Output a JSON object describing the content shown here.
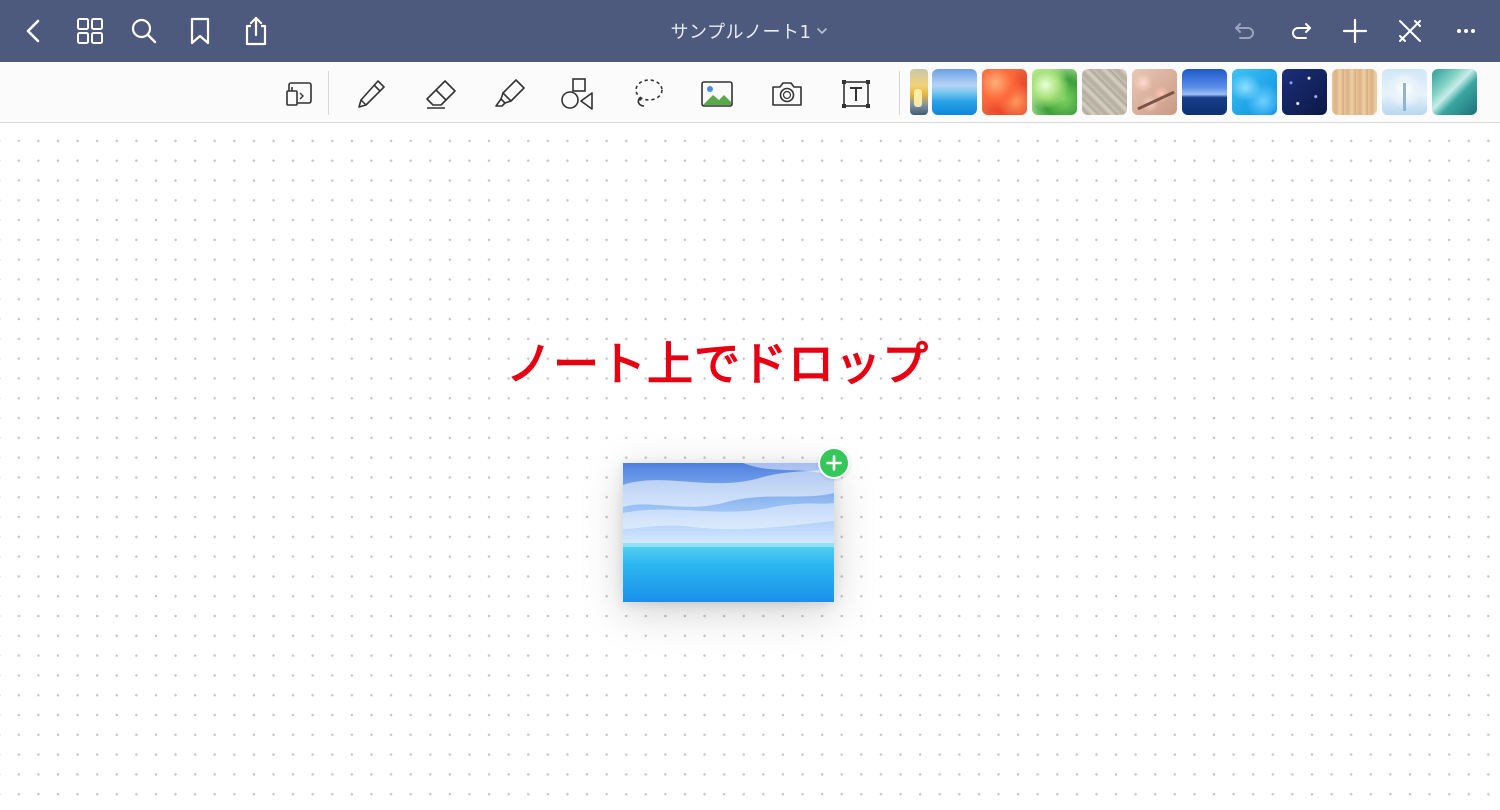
{
  "navbar": {
    "title": "サンプルノート1",
    "left_icons": [
      "back-icon",
      "grid-icon",
      "search-icon",
      "bookmark-icon",
      "share-icon"
    ],
    "right_icons": [
      "undo-icon",
      "redo-icon",
      "plus-icon",
      "close-toolbar-icon",
      "more-icon"
    ]
  },
  "toolbar": {
    "tools": [
      "page-layout-icon",
      "pen-icon",
      "eraser-icon",
      "highlighter-icon",
      "shapes-icon",
      "lasso-icon",
      "image-icon",
      "camera-icon",
      "text-box-icon"
    ],
    "image_tiles": [
      "sunset-sea",
      "blue-sea",
      "autumn-leaves",
      "green-leaves",
      "stone-wall",
      "cherry-blossom-branch",
      "night-lake",
      "water-surface",
      "starry-sky",
      "wood-grain",
      "snowy-tree",
      "sea-glass"
    ]
  },
  "canvas": {
    "drop_label": "ノート上でドロップ",
    "dragged_image": "blue-sea"
  },
  "colors": {
    "navbar": "#4d5a7e",
    "label": "#e60012",
    "badge": "#35c759"
  }
}
